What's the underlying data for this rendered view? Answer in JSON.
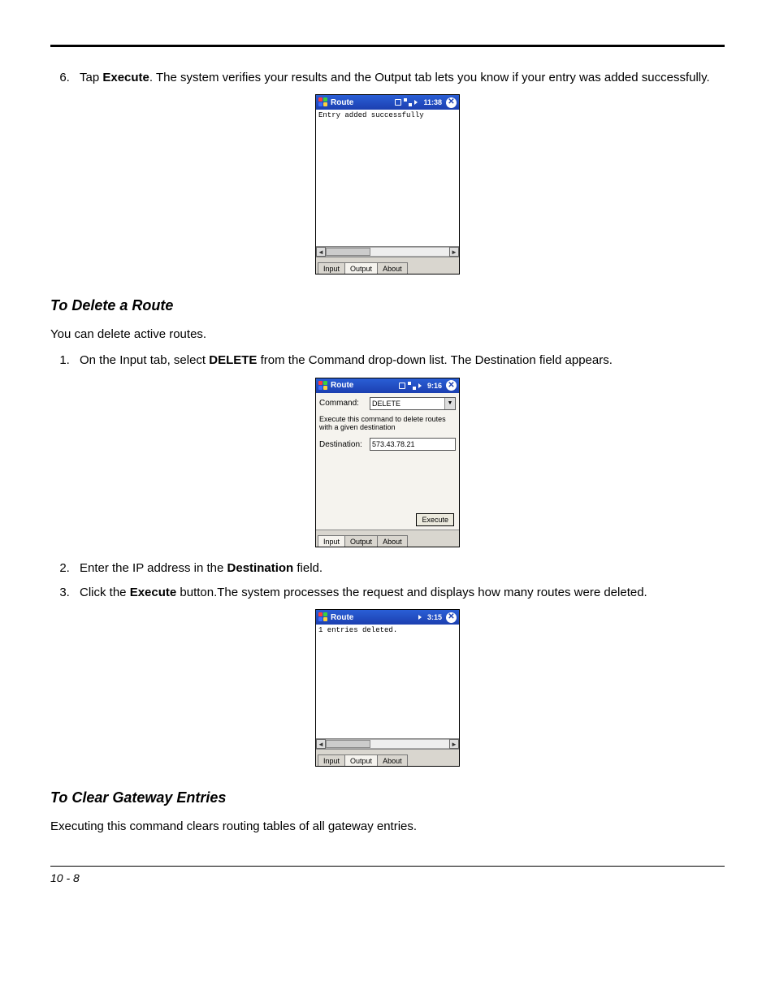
{
  "step6": {
    "number": "6.",
    "prefix": "Tap ",
    "bold": "Execute",
    "suffix": ". The system verifies your results and the Output tab lets you know if your entry was added successfully."
  },
  "shot1": {
    "title": "Route",
    "time": "11:38",
    "close": "✕",
    "output_text": "Entry added successfully",
    "tabs": {
      "input": "Input",
      "output": "Output",
      "about": "About"
    },
    "sb_left": "◄",
    "sb_right": "►"
  },
  "heading_delete": "To Delete a Route",
  "delete_intro": "You can delete active routes.",
  "delete_steps": {
    "s1": {
      "prefix": "On the Input tab, select ",
      "bold": "DELETE",
      "suffix": " from the Command drop-down list. The Destination field appears."
    },
    "s2": {
      "prefix": "Enter the IP address in the ",
      "bold": "Destination",
      "suffix": " field."
    },
    "s3": {
      "prefix": "Click the ",
      "bold": "Execute",
      "suffix": " button.The system processes the request and displays how many routes were deleted."
    }
  },
  "shot2": {
    "title": "Route",
    "time": "9:16",
    "close": "✕",
    "command_label": "Command:",
    "command_value": "DELETE",
    "dropdown_arrow": "▼",
    "desc": "Execute this command to delete routes with a given destination",
    "dest_label": "Destination:",
    "dest_value": "573.43.78.21",
    "execute_btn": "Execute",
    "tabs": {
      "input": "Input",
      "output": "Output",
      "about": "About"
    }
  },
  "shot3": {
    "title": "Route",
    "time": "3:15",
    "close": "✕",
    "output_text": "1 entries deleted.",
    "tabs": {
      "input": "Input",
      "output": "Output",
      "about": "About"
    },
    "sb_left": "◄",
    "sb_right": "►"
  },
  "heading_clear": "To Clear Gateway Entries",
  "clear_intro": "Executing this command clears routing tables of all gateway entries.",
  "page_number": "10 - 8"
}
